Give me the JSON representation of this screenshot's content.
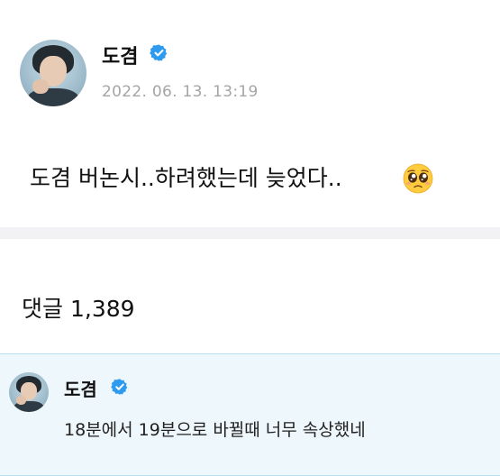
{
  "post": {
    "author": "도겸",
    "verified_icon": "verified-badge-icon",
    "timestamp": "2022. 06. 13. 13:19",
    "text": "도겸 버논시..하려했는데 늦었다..",
    "emoji": "pleading-face-emoji"
  },
  "comments": {
    "label": "댓글",
    "count": "1,389"
  },
  "comment": {
    "author": "도겸",
    "text": "18분에서 19분으로 바뀔때 너무 속상했네"
  },
  "colors": {
    "verified": "#2f9bef",
    "timestamp": "#a5a5a5",
    "divider": "#f2f2f5",
    "comment_bg": "#eef7fb",
    "comment_border": "#b9dded"
  }
}
